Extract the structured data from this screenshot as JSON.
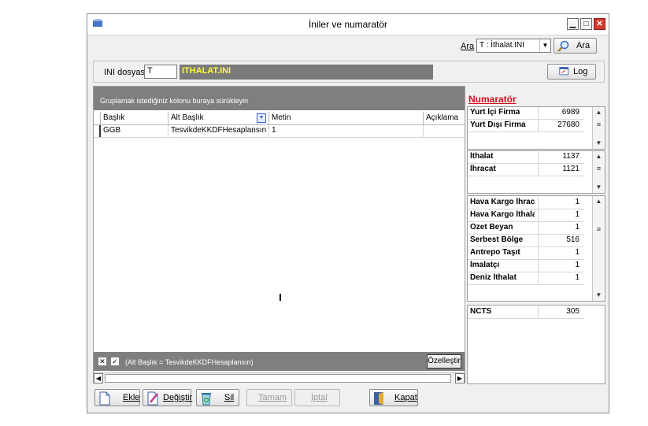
{
  "window": {
    "title": "İniler ve numaratör"
  },
  "search": {
    "label": "Ara",
    "selected": "T : İthalat.INI",
    "button_label": "Ara"
  },
  "ini": {
    "label": "INI dosyası",
    "value": "T",
    "name": "ITHALAT.INI",
    "log_button": "Log"
  },
  "grid": {
    "group_hint": "Gruplamak istediğiniz kolonu buraya sürükleyin",
    "columns": [
      "Başlık",
      "Alt Başlık",
      "Metin",
      "Açıklama"
    ],
    "rows": [
      [
        "GGB",
        "TesvikdeKKDFHesaplansın",
        "1",
        ""
      ]
    ],
    "filter_text": "(Alt Başlık = TesvikdeKKDFHesaplansın)",
    "customize_button": "Özelleştir"
  },
  "numerator": {
    "title": "Numaratör",
    "group1": [
      {
        "name": "Yurt İçi Firma",
        "value": "6989"
      },
      {
        "name": "Yurt Dışı Firma",
        "value": "27680"
      }
    ],
    "group2": [
      {
        "name": "İthalat",
        "value": "1137"
      },
      {
        "name": "İhracat",
        "value": "1121"
      }
    ],
    "group3": [
      {
        "name": "Hava Kargo İhracat",
        "value": "1"
      },
      {
        "name": "Hava Kargo İthalat",
        "value": "1"
      },
      {
        "name": "Özet Beyan",
        "value": "1"
      },
      {
        "name": "Serbest Bölge",
        "value": "516"
      },
      {
        "name": "Antrepo Taşıt",
        "value": "1"
      },
      {
        "name": "İmalatçı",
        "value": "1"
      },
      {
        "name": "Deniz İthalat",
        "value": "1"
      }
    ],
    "group4": [
      {
        "name": "NCTS",
        "value": "305"
      }
    ]
  },
  "toolbar": {
    "add": "Ekle",
    "edit": "Değiştir",
    "delete": "Sil",
    "ok": "Tamam",
    "cancel": "İptal",
    "close": "Kapat"
  },
  "colors": {
    "accent": "#d0101f",
    "ini_name_text": "#ffff3a",
    "panel_gray": "#7f7f7f"
  }
}
